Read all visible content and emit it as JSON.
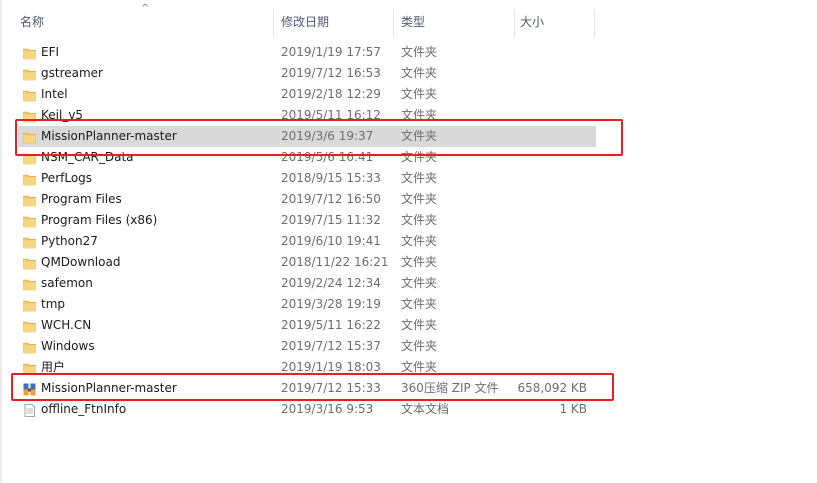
{
  "columns": {
    "name": "名称",
    "modified": "修改日期",
    "type": "类型",
    "size": "大小"
  },
  "sort_indicator": "^",
  "files": [
    {
      "name": "EFI",
      "date": "2019/1/19 17:57",
      "type": "文件夹",
      "size": "",
      "icon": "folder-icon"
    },
    {
      "name": "gstreamer",
      "date": "2019/7/12 16:53",
      "type": "文件夹",
      "size": "",
      "icon": "folder-icon"
    },
    {
      "name": "Intel",
      "date": "2019/2/18 12:29",
      "type": "文件夹",
      "size": "",
      "icon": "folder-icon"
    },
    {
      "name": "Keil_v5",
      "date": "2019/5/11 16:12",
      "type": "文件夹",
      "size": "",
      "icon": "folder-icon"
    },
    {
      "name": "MissionPlanner-master",
      "date": "2019/3/6 19:37",
      "type": "文件夹",
      "size": "",
      "icon": "folder-icon",
      "selected": true
    },
    {
      "name": "NSM_CAR_Data",
      "date": "2019/5/6 16:41",
      "type": "文件夹",
      "size": "",
      "icon": "folder-icon"
    },
    {
      "name": "PerfLogs",
      "date": "2018/9/15 15:33",
      "type": "文件夹",
      "size": "",
      "icon": "folder-icon"
    },
    {
      "name": "Program Files",
      "date": "2019/7/12 16:50",
      "type": "文件夹",
      "size": "",
      "icon": "folder-icon"
    },
    {
      "name": "Program Files (x86)",
      "date": "2019/7/15 11:32",
      "type": "文件夹",
      "size": "",
      "icon": "folder-icon"
    },
    {
      "name": "Python27",
      "date": "2019/6/10 19:41",
      "type": "文件夹",
      "size": "",
      "icon": "folder-icon"
    },
    {
      "name": "QMDownload",
      "date": "2018/11/22 16:21",
      "type": "文件夹",
      "size": "",
      "icon": "folder-icon"
    },
    {
      "name": "safemon",
      "date": "2019/2/24 12:34",
      "type": "文件夹",
      "size": "",
      "icon": "folder-icon"
    },
    {
      "name": "tmp",
      "date": "2019/3/28 19:19",
      "type": "文件夹",
      "size": "",
      "icon": "folder-icon"
    },
    {
      "name": "WCH.CN",
      "date": "2019/5/11 16:22",
      "type": "文件夹",
      "size": "",
      "icon": "folder-icon"
    },
    {
      "name": "Windows",
      "date": "2019/7/12 15:37",
      "type": "文件夹",
      "size": "",
      "icon": "folder-icon"
    },
    {
      "name": "用户",
      "date": "2019/1/19 18:03",
      "type": "文件夹",
      "size": "",
      "icon": "folder-icon"
    },
    {
      "name": "MissionPlanner-master",
      "date": "2019/7/12 15:33",
      "type": "360压缩 ZIP 文件",
      "size": "658,092 KB",
      "icon": "zip-archive-icon"
    },
    {
      "name": "offline_FtnInfo",
      "date": "2019/3/16 9:53",
      "type": "文本文档",
      "size": "1 KB",
      "icon": "text-document-icon"
    }
  ],
  "colors": {
    "highlight_box": "#e52020",
    "selected_row": "#d9d9d9",
    "folder": "#f2c55c"
  }
}
